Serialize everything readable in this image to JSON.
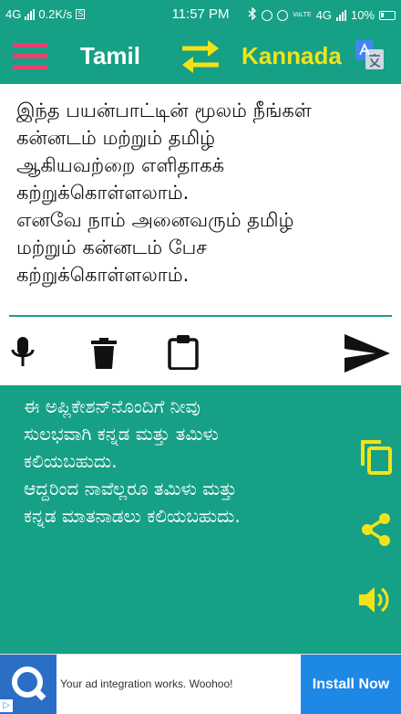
{
  "status_bar": {
    "network": "4G",
    "speed": "0.2K/s",
    "s_badge": "S",
    "time": "11:57 PM",
    "volte": "VoLTE",
    "network2": "4G",
    "battery": "10%"
  },
  "toolbar": {
    "source_language": "Tamil",
    "target_language": "Kannada"
  },
  "input": {
    "text": "இந்த பயன்பாட்டின் மூலம் நீங்கள்\nகன்னடம் மற்றும் தமிழ்\nஆகியவற்றை எளிதாகக்\nகற்றுக்கொள்ளலாம்.\nஎனவே நாம் அனைவரும் தமிழ்\nமற்றும் கன்னடம் பேச\nகற்றுக்கொள்ளலாம்."
  },
  "output": {
    "text": "ಈ ಅಪ್ಲಿಕೇಶನ್‌ನೊಂದಿಗೆ ನೀವು\nಸುಲಭವಾಗಿ ಕನ್ನಡ ಮತ್ತು ತಮಿಳು\nಕಲಿಯಬಹುದು.\nಆದ್ದರಿಂದ ನಾವೆಲ್ಲರೂ ತಮಿಳು ಮತ್ತು\nಕನ್ನಡ ಮಾತನಾಡಲು ಕಲಿಯಬಹುದು."
  },
  "ad": {
    "text": "Your ad integration works. Woohoo!",
    "button_label": "Install Now"
  },
  "colors": {
    "primary": "#16a085",
    "accent_pink": "#e8436e",
    "accent_yellow": "#f2e318"
  }
}
